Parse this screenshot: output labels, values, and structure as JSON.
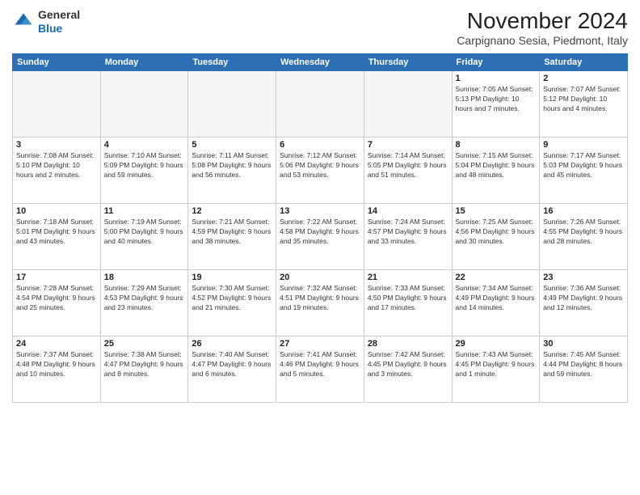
{
  "logo": {
    "general": "General",
    "blue": "Blue"
  },
  "header": {
    "month_year": "November 2024",
    "location": "Carpignano Sesia, Piedmont, Italy"
  },
  "weekdays": [
    "Sunday",
    "Monday",
    "Tuesday",
    "Wednesday",
    "Thursday",
    "Friday",
    "Saturday"
  ],
  "weeks": [
    [
      {
        "day": "",
        "info": ""
      },
      {
        "day": "",
        "info": ""
      },
      {
        "day": "",
        "info": ""
      },
      {
        "day": "",
        "info": ""
      },
      {
        "day": "",
        "info": ""
      },
      {
        "day": "1",
        "info": "Sunrise: 7:05 AM\nSunset: 5:13 PM\nDaylight: 10 hours and 7 minutes."
      },
      {
        "day": "2",
        "info": "Sunrise: 7:07 AM\nSunset: 5:12 PM\nDaylight: 10 hours and 4 minutes."
      }
    ],
    [
      {
        "day": "3",
        "info": "Sunrise: 7:08 AM\nSunset: 5:10 PM\nDaylight: 10 hours and 2 minutes."
      },
      {
        "day": "4",
        "info": "Sunrise: 7:10 AM\nSunset: 5:09 PM\nDaylight: 9 hours and 59 minutes."
      },
      {
        "day": "5",
        "info": "Sunrise: 7:11 AM\nSunset: 5:08 PM\nDaylight: 9 hours and 56 minutes."
      },
      {
        "day": "6",
        "info": "Sunrise: 7:12 AM\nSunset: 5:06 PM\nDaylight: 9 hours and 53 minutes."
      },
      {
        "day": "7",
        "info": "Sunrise: 7:14 AM\nSunset: 5:05 PM\nDaylight: 9 hours and 51 minutes."
      },
      {
        "day": "8",
        "info": "Sunrise: 7:15 AM\nSunset: 5:04 PM\nDaylight: 9 hours and 48 minutes."
      },
      {
        "day": "9",
        "info": "Sunrise: 7:17 AM\nSunset: 5:03 PM\nDaylight: 9 hours and 45 minutes."
      }
    ],
    [
      {
        "day": "10",
        "info": "Sunrise: 7:18 AM\nSunset: 5:01 PM\nDaylight: 9 hours and 43 minutes."
      },
      {
        "day": "11",
        "info": "Sunrise: 7:19 AM\nSunset: 5:00 PM\nDaylight: 9 hours and 40 minutes."
      },
      {
        "day": "12",
        "info": "Sunrise: 7:21 AM\nSunset: 4:59 PM\nDaylight: 9 hours and 38 minutes."
      },
      {
        "day": "13",
        "info": "Sunrise: 7:22 AM\nSunset: 4:58 PM\nDaylight: 9 hours and 35 minutes."
      },
      {
        "day": "14",
        "info": "Sunrise: 7:24 AM\nSunset: 4:57 PM\nDaylight: 9 hours and 33 minutes."
      },
      {
        "day": "15",
        "info": "Sunrise: 7:25 AM\nSunset: 4:56 PM\nDaylight: 9 hours and 30 minutes."
      },
      {
        "day": "16",
        "info": "Sunrise: 7:26 AM\nSunset: 4:55 PM\nDaylight: 9 hours and 28 minutes."
      }
    ],
    [
      {
        "day": "17",
        "info": "Sunrise: 7:28 AM\nSunset: 4:54 PM\nDaylight: 9 hours and 25 minutes."
      },
      {
        "day": "18",
        "info": "Sunrise: 7:29 AM\nSunset: 4:53 PM\nDaylight: 9 hours and 23 minutes."
      },
      {
        "day": "19",
        "info": "Sunrise: 7:30 AM\nSunset: 4:52 PM\nDaylight: 9 hours and 21 minutes."
      },
      {
        "day": "20",
        "info": "Sunrise: 7:32 AM\nSunset: 4:51 PM\nDaylight: 9 hours and 19 minutes."
      },
      {
        "day": "21",
        "info": "Sunrise: 7:33 AM\nSunset: 4:50 PM\nDaylight: 9 hours and 17 minutes."
      },
      {
        "day": "22",
        "info": "Sunrise: 7:34 AM\nSunset: 4:49 PM\nDaylight: 9 hours and 14 minutes."
      },
      {
        "day": "23",
        "info": "Sunrise: 7:36 AM\nSunset: 4:49 PM\nDaylight: 9 hours and 12 minutes."
      }
    ],
    [
      {
        "day": "24",
        "info": "Sunrise: 7:37 AM\nSunset: 4:48 PM\nDaylight: 9 hours and 10 minutes."
      },
      {
        "day": "25",
        "info": "Sunrise: 7:38 AM\nSunset: 4:47 PM\nDaylight: 9 hours and 8 minutes."
      },
      {
        "day": "26",
        "info": "Sunrise: 7:40 AM\nSunset: 4:47 PM\nDaylight: 9 hours and 6 minutes."
      },
      {
        "day": "27",
        "info": "Sunrise: 7:41 AM\nSunset: 4:46 PM\nDaylight: 9 hours and 5 minutes."
      },
      {
        "day": "28",
        "info": "Sunrise: 7:42 AM\nSunset: 4:45 PM\nDaylight: 9 hours and 3 minutes."
      },
      {
        "day": "29",
        "info": "Sunrise: 7:43 AM\nSunset: 4:45 PM\nDaylight: 9 hours and 1 minute."
      },
      {
        "day": "30",
        "info": "Sunrise: 7:45 AM\nSunset: 4:44 PM\nDaylight: 8 hours and 59 minutes."
      }
    ]
  ]
}
